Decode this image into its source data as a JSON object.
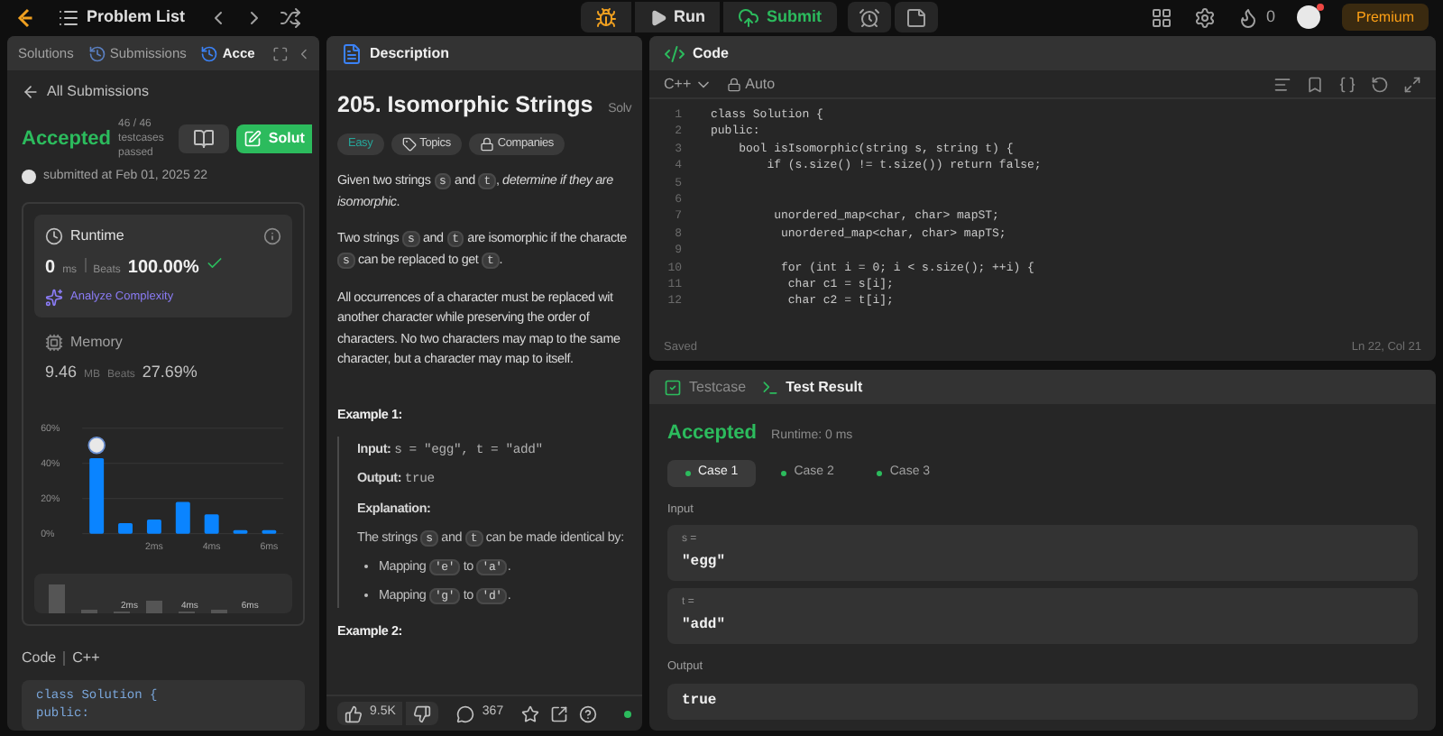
{
  "top_bar": {
    "problem_list": "Problem List",
    "run": "Run",
    "submit": "Submit",
    "streak_count": "0",
    "premium": "Premium",
    "has_notification": true
  },
  "submission_panel": {
    "tabs": [
      {
        "label": "Solutions",
        "selected": false
      },
      {
        "label": "Submissions",
        "selected": false
      },
      {
        "label": "Acce",
        "selected": true
      }
    ],
    "back_link": "All Submissions",
    "status": "Accepted",
    "testcases": "46 / 46 testcases passed",
    "solution_button": "Solut",
    "submitted": "submitted at Feb 01, 2025 22",
    "runtime": {
      "label": "Runtime",
      "value": "0",
      "unit": "ms",
      "beats_label": "Beats",
      "beats": "100.00%",
      "analyze": "Analyze Complexity"
    },
    "memory": {
      "label": "Memory",
      "value": "9.46",
      "unit": "MB",
      "beats_label": "Beats",
      "beats": "27.69%"
    },
    "chart_data": {
      "type": "bar",
      "x": [
        0,
        1,
        2,
        3,
        4,
        5,
        6
      ],
      "series": [
        {
          "color": "#0a84ff",
          "values": [
            43,
            6,
            8,
            18,
            11,
            2,
            2
          ]
        }
      ],
      "xlim": [
        -0.5,
        6.5
      ],
      "ylim": [
        0,
        60
      ],
      "yticks": [
        {
          "value": 0,
          "label": "0%"
        },
        {
          "value": 20,
          "label": "20%"
        },
        {
          "value": 40,
          "label": "40%"
        },
        {
          "value": 60,
          "label": "60%"
        }
      ],
      "xticks": [
        {
          "value": 2,
          "label": "2ms"
        },
        {
          "value": 4,
          "label": "4ms"
        },
        {
          "value": 6,
          "label": "6ms"
        }
      ]
    },
    "overview_labels": [
      "2ms",
      "4ms",
      "6ms"
    ],
    "code_label": "Code",
    "code_language": "C++",
    "code_lines": [
      "class Solution {",
      "public:"
    ]
  },
  "description_panel": {
    "header": "Description",
    "title": "205. Isomorphic Strings",
    "solved_label": "Solv",
    "tags": [
      {
        "kind": "difficulty",
        "label": "Easy"
      },
      {
        "kind": "topics",
        "label": "Topics"
      },
      {
        "kind": "companies",
        "label": "Companies"
      }
    ],
    "paragraphs": [
      {
        "lines": [
          [
            {
              "kind": "text",
              "text": "Given two strings "
            },
            {
              "kind": "code",
              "text": "s"
            },
            {
              "kind": "text",
              "text": " and "
            },
            {
              "kind": "code",
              "text": "t"
            },
            {
              "kind": "text",
              "text": ", "
            },
            {
              "kind": "italic",
              "text": "determine if they are"
            }
          ],
          [
            {
              "kind": "italic",
              "text": "isomorphic"
            },
            {
              "kind": "text",
              "text": "."
            }
          ]
        ]
      },
      {
        "lines": [
          [
            {
              "kind": "text",
              "text": "Two strings "
            },
            {
              "kind": "code",
              "text": "s"
            },
            {
              "kind": "text",
              "text": " and "
            },
            {
              "kind": "code",
              "text": "t"
            },
            {
              "kind": "text",
              "text": " are isomorphic if the characte"
            }
          ],
          [
            {
              "kind": "code",
              "text": "s"
            },
            {
              "kind": "text",
              "text": " can be replaced to get "
            },
            {
              "kind": "code",
              "text": "t"
            },
            {
              "kind": "text",
              "text": "."
            }
          ]
        ]
      },
      {
        "lines": [
          [
            {
              "kind": "text",
              "text": "All occurrences of a character must be replaced wit"
            }
          ],
          [
            {
              "kind": "text",
              "text": "another character while preserving the order of"
            }
          ],
          [
            {
              "kind": "text",
              "text": "characters. No two characters may map to the same"
            }
          ],
          [
            {
              "kind": "text",
              "text": "character, but a character may map to itself."
            }
          ]
        ]
      }
    ],
    "example": {
      "title": "Example 1:",
      "input_label": "Input:",
      "input": "s = \"egg\", t = \"add\"",
      "output_label": "Output:",
      "output": "true",
      "explanation_label": "Explanation:",
      "explanation": [
        {
          "kind": "text",
          "text": "The strings "
        },
        {
          "kind": "code",
          "text": "s"
        },
        {
          "kind": "text",
          "text": " and "
        },
        {
          "kind": "code",
          "text": "t"
        },
        {
          "kind": "text",
          "text": " can be made identical by:"
        }
      ],
      "bullets": [
        [
          {
            "kind": "text",
            "text": "Mapping "
          },
          {
            "kind": "code",
            "text": "'e'"
          },
          {
            "kind": "text",
            "text": " to "
          },
          {
            "kind": "code",
            "text": "'a'"
          },
          {
            "kind": "text",
            "text": "."
          }
        ],
        [
          {
            "kind": "text",
            "text": "Mapping "
          },
          {
            "kind": "code",
            "text": "'g'"
          },
          {
            "kind": "text",
            "text": " to "
          },
          {
            "kind": "code",
            "text": "'d'"
          },
          {
            "kind": "text",
            "text": "."
          }
        ]
      ]
    },
    "next_example": "Example 2:",
    "likes": "9.5K",
    "comments": "367"
  },
  "code_panel": {
    "header": "Code",
    "language": "C++",
    "mode": "Auto",
    "lines": [
      {
        "number": "1",
        "code": "class Solution {"
      },
      {
        "number": "2",
        "code": "public:"
      },
      {
        "number": "3",
        "code": "    bool isIsomorphic(string s, string t) {"
      },
      {
        "number": "4",
        "code": "        if (s.size() != t.size()) return false;"
      },
      {
        "number": "5"
      },
      {
        "number": "6"
      },
      {
        "number": "7",
        "code": "         unordered_map<char, char> mapST;"
      },
      {
        "number": "8",
        "code": "          unordered_map<char, char> mapTS;"
      },
      {
        "number": "9"
      },
      {
        "number": "10",
        "code": "          for (int i = 0; i < s.size(); ++i) {"
      },
      {
        "number": "11",
        "code": "           char c1 = s[i];"
      },
      {
        "number": "12",
        "code": "           char c2 = t[i];"
      }
    ],
    "status": "Saved",
    "cursor": "Ln 22, Col 21"
  },
  "result_panel": {
    "tabs": [
      {
        "label": "Testcase",
        "selected": false
      },
      {
        "label": "Test Result",
        "selected": true
      }
    ],
    "status": "Accepted",
    "runtime": "Runtime: 0 ms",
    "cases": [
      {
        "label": "Case 1",
        "selected": true
      },
      {
        "label": "Case 2",
        "selected": false
      },
      {
        "label": "Case 3",
        "selected": false
      }
    ],
    "input_label": "Input",
    "inputs": [
      {
        "name": "s =",
        "value": "\"egg\""
      },
      {
        "name": "t =",
        "value": "\"add\""
      }
    ],
    "output_label": "Output",
    "output": "true"
  }
}
